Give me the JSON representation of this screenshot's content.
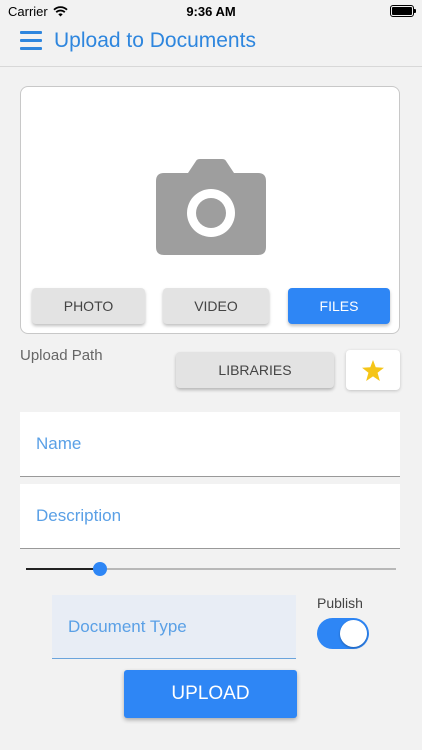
{
  "status_bar": {
    "carrier": "Carrier",
    "time": "9:36 AM",
    "wifi_icon": "wifi-icon",
    "battery_icon": "battery-icon"
  },
  "nav": {
    "title": "Upload to Documents",
    "menu_icon": "hamburger-menu-icon"
  },
  "media": {
    "preview_icon": "camera-icon",
    "buttons": [
      {
        "label": "PHOTO",
        "selected": false
      },
      {
        "label": "VIDEO",
        "selected": false
      },
      {
        "label": "FILES",
        "selected": true
      }
    ]
  },
  "upload_path": {
    "label": "Upload Path",
    "libraries_label": "LIBRARIES",
    "favorite_icon": "star-icon"
  },
  "form": {
    "name_placeholder": "Name",
    "name_value": "",
    "description_placeholder": "Description",
    "description_value": "",
    "slider_fraction": 0.2,
    "document_type_placeholder": "Document Type",
    "document_type_value": "",
    "publish_label": "Publish",
    "publish_on": true,
    "upload_label": "UPLOAD"
  },
  "colors": {
    "accent": "#2e86f5",
    "title_blue": "#2e86de",
    "star": "#f5c518",
    "camera_grey": "#9e9e9e"
  }
}
